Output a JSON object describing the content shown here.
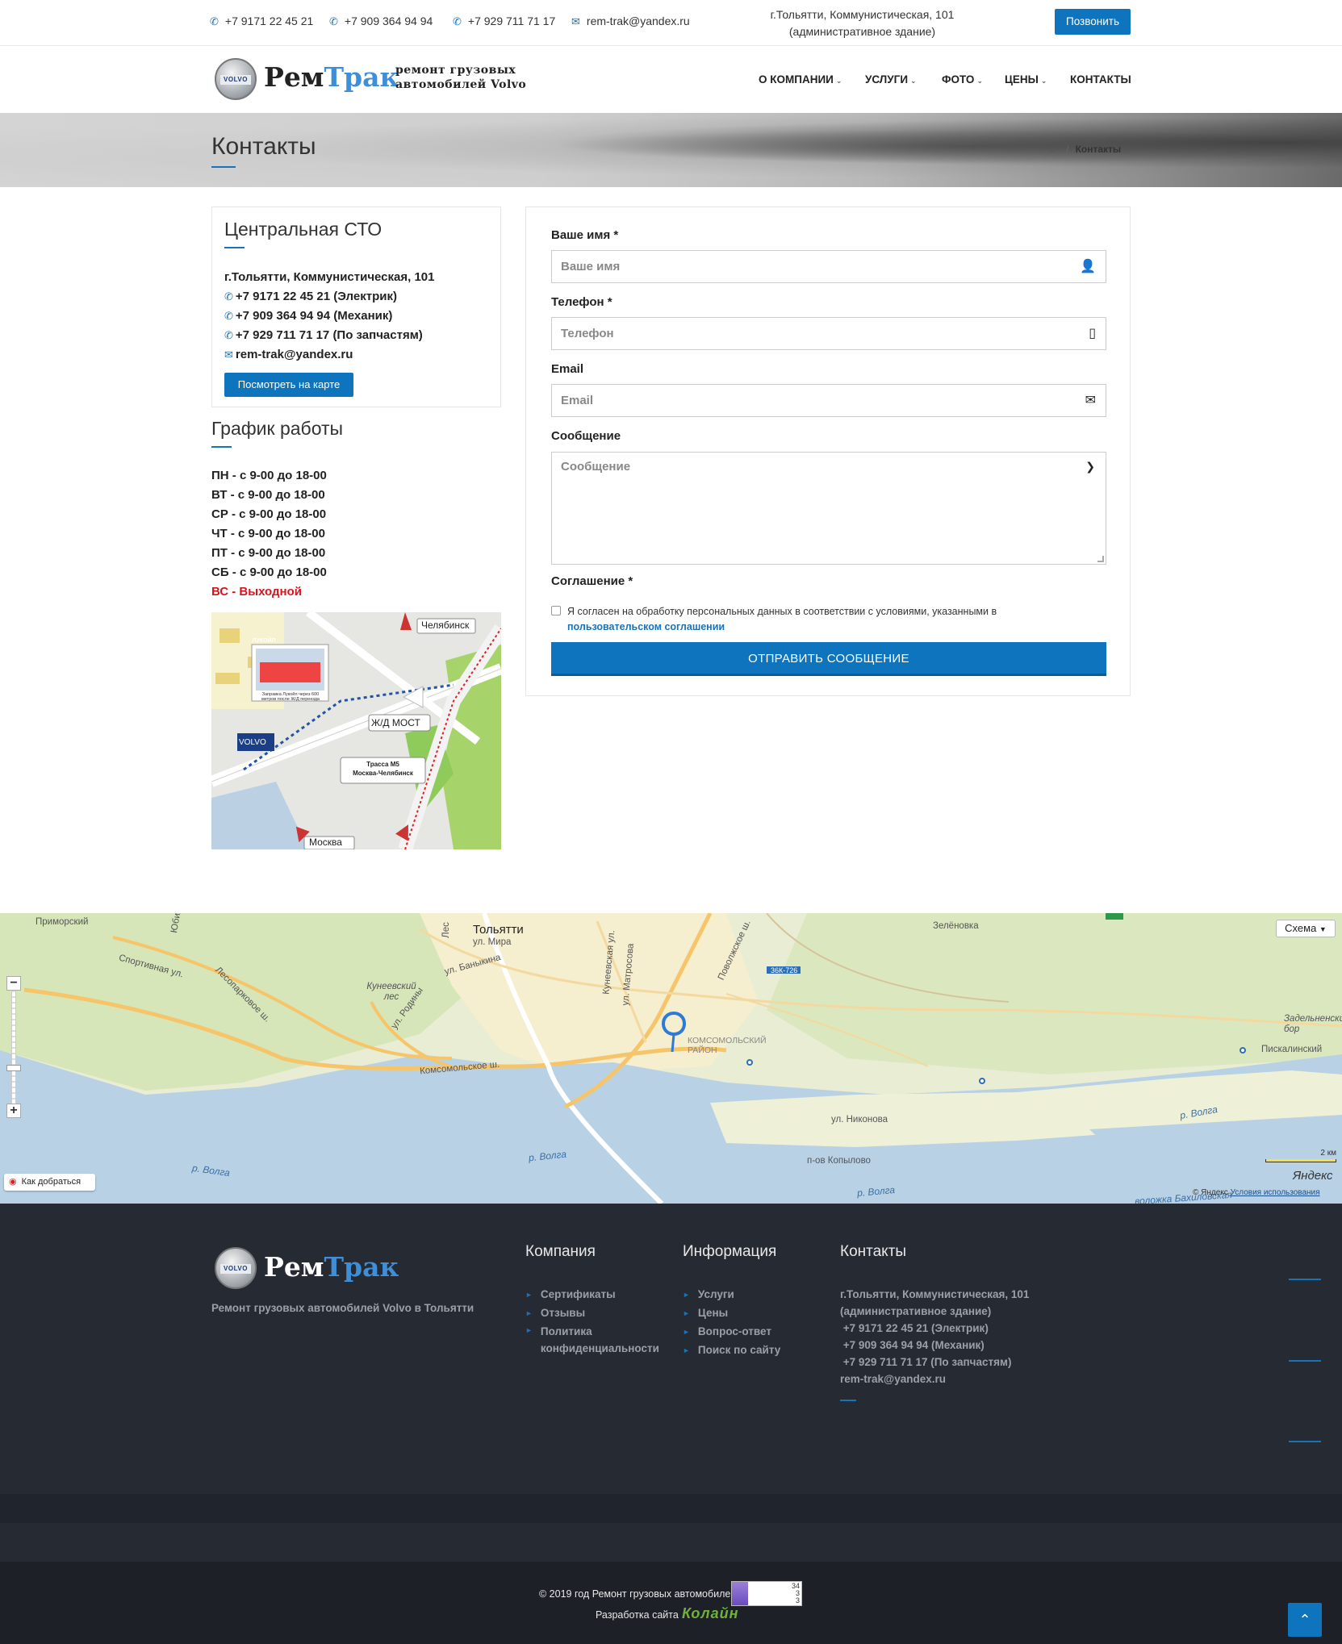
{
  "topbar": {
    "phones": [
      "+7 9171 22 45 21",
      "+7 909 364 94 94",
      "+7 929 711 71 17"
    ],
    "email": "rem-trak@yandex.ru",
    "address_line1": "г.Тольятти, Коммунистическая, 101",
    "address_line2": "(административное здание)",
    "call_button": "Позвонить"
  },
  "logo": {
    "brand_a": "Рем",
    "brand_b": "Трак",
    "badge": "VOLVO",
    "tagline_1": "ремонт грузовых",
    "tagline_2": "автомобилей Volvo"
  },
  "nav": [
    {
      "label": "О КОМПАНИИ",
      "has_dropdown": true
    },
    {
      "label": "УСЛУГИ",
      "has_dropdown": true
    },
    {
      "label": "ФОТО",
      "has_dropdown": true
    },
    {
      "label": "ЦЕНЫ",
      "has_dropdown": true
    },
    {
      "label": "КОНТАКТЫ",
      "has_dropdown": false
    }
  ],
  "page": {
    "title": "Контакты",
    "breadcrumb_current": "Контакты"
  },
  "station": {
    "title": "Центральная СТО",
    "address": "г.Тольятти, Коммунистическая, 101",
    "phone_1": "+7 9171 22 45 21 (Электрик)",
    "phone_2": "+7 909 364 94 94 (Механик)",
    "phone_3": "+7 929 711 71 17 (По запчастям)",
    "email": "rem-trak@yandex.ru",
    "map_button": "Посмотреть на карте"
  },
  "schedule": {
    "title": "График работы",
    "days": [
      "ПН - с 9-00 до 18-00",
      "ВТ - с 9-00 до 18-00",
      "СР - с 9-00 до 18-00",
      "ЧТ - с 9-00 до 18-00",
      "ПТ - с 9-00 до 18-00",
      "СБ - с 9-00 до 18-00"
    ],
    "sunday": "ВС - Выходной"
  },
  "route_map": {
    "label_chelyabinsk": "Челябинск",
    "label_moscow": "Москва",
    "label_bridge": "Ж/Д МОСТ",
    "label_highway_1": "Трасса М5",
    "label_highway_2": "Москва-Челябинск",
    "label_lukoil": "ЛУКОЙЛ",
    "label_fuel_1": "Заправка Лукойл через 600",
    "label_fuel_2": "метров после Ж/Д переезда",
    "label_volvo": "VOLVO"
  },
  "form": {
    "name_label": "Ваше имя *",
    "name_placeholder": "Ваше имя",
    "phone_label": "Телефон *",
    "phone_placeholder": "Телефон",
    "email_label": "Email",
    "email_placeholder": "Email",
    "message_label": "Сообщение",
    "message_placeholder": "Сообщение",
    "agreement_label": "Соглашение *",
    "agreement_text": "Я согласен на обработку персональных данных в соответствии с условиями, указанными в",
    "agreement_link": "пользовательском соглашении",
    "agreement_checked": false,
    "submit": "ОТПРАВИТЬ СООБЩЕНИЕ"
  },
  "bigmap": {
    "city": "Тольятти",
    "labels": [
      "Приморский",
      "Зелёновка",
      "ул. Мира",
      "ул. Баныкина",
      "Кунеевский лес",
      "Спортивная ул.",
      "Лесопарковое ш.",
      "ул. Родины",
      "Комсомольское ш.",
      "ул. Матросова",
      "Кунеевская ул.",
      "Поволжское ш.",
      "36К-726",
      "Комсомольский район",
      "Задельненский бор",
      "Пискалинский",
      "ул. Никонова",
      "п-ов Копылово",
      "Юбил",
      "Лес",
      "воложка Бахиловская"
    ],
    "river_labels": [
      "р. Волга",
      "р. Волга",
      "р. Волга",
      "р. Волга"
    ],
    "scheme_button": "Схема",
    "route_button": "Как добраться",
    "scale": "2 км",
    "provider": "Яндекс",
    "copyright": "© Яндекс",
    "terms": "Условия использования"
  },
  "footer": {
    "tagline": "Ремонт грузовых автомобилей Volvo в Тольятти",
    "company_title": "Компания",
    "company_links": [
      "Сертификаты",
      "Отзывы",
      "Политика конфиденциальности"
    ],
    "info_title": "Информация",
    "info_links": [
      "Услуги",
      "Цены",
      "Вопрос-ответ",
      "Поиск по сайту"
    ],
    "contacts_title": "Контакты",
    "contacts": [
      "г.Тольятти, Коммунистическая, 101",
      "(административное здание)",
      " +7 9171 22 45 21 (Электрик)",
      " +7 909 364 94 94 (Механик)",
      " +7 929 711 71 17 (По запчастям)",
      "rem-trak@yandex.ru"
    ],
    "copyright": "© 2019 год Ремонт грузовых автомобилей",
    "counter": [
      "34",
      "3",
      "3"
    ],
    "developer_label": "Разработка сайта",
    "developer_name": "Колайн"
  },
  "colors": {
    "accent": "#0e74bd",
    "footer_bg": "#262a33",
    "sunday_red": "#d9141c"
  }
}
